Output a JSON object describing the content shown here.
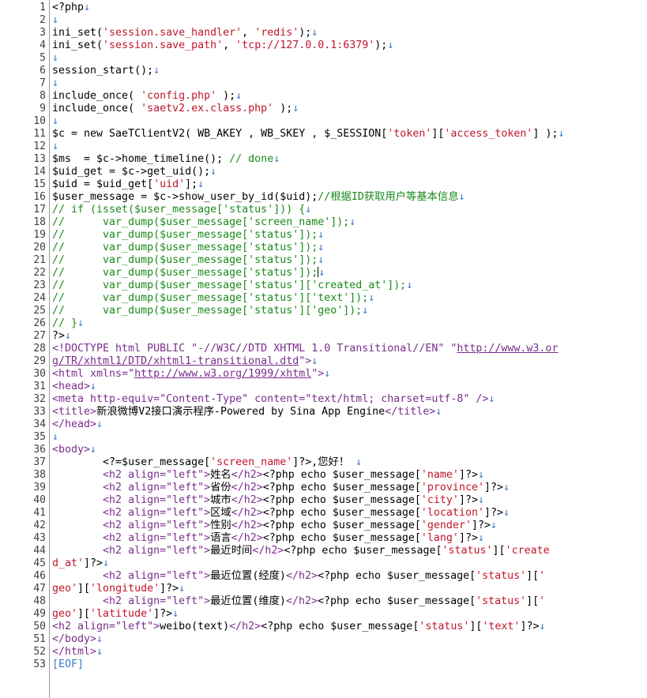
{
  "editor": {
    "eof_marker": "[EOF]",
    "lines": [
      {
        "n": "1",
        "segs": [
          {
            "c": "key",
            "t": "<?php"
          }
        ]
      },
      {
        "n": "2",
        "segs": []
      },
      {
        "n": "3",
        "segs": [
          {
            "c": "key",
            "t": "ini_set("
          },
          {
            "c": "str",
            "t": "'session.save_handler'"
          },
          {
            "c": "key",
            "t": ", "
          },
          {
            "c": "str",
            "t": "'redis'"
          },
          {
            "c": "key",
            "t": ");"
          }
        ]
      },
      {
        "n": "4",
        "segs": [
          {
            "c": "key",
            "t": "ini_set("
          },
          {
            "c": "str",
            "t": "'session.save_path'"
          },
          {
            "c": "key",
            "t": ", "
          },
          {
            "c": "str",
            "t": "'tcp://127.0.0.1:6379'"
          },
          {
            "c": "key",
            "t": ");"
          }
        ]
      },
      {
        "n": "5",
        "segs": []
      },
      {
        "n": "6",
        "segs": [
          {
            "c": "key",
            "t": "session_start();"
          }
        ]
      },
      {
        "n": "7",
        "segs": []
      },
      {
        "n": "8",
        "segs": [
          {
            "c": "key",
            "t": "include_once( "
          },
          {
            "c": "str",
            "t": "'config.php'"
          },
          {
            "c": "key",
            "t": " );"
          }
        ]
      },
      {
        "n": "9",
        "segs": [
          {
            "c": "key",
            "t": "include_once( "
          },
          {
            "c": "str",
            "t": "'saetv2.ex.class.php'"
          },
          {
            "c": "key",
            "t": " );"
          }
        ]
      },
      {
        "n": "10",
        "segs": []
      },
      {
        "n": "11",
        "segs": [
          {
            "c": "key",
            "t": "$c = new SaeTClientV2( WB_AKEY , WB_SKEY , $_SESSION["
          },
          {
            "c": "str",
            "t": "'token'"
          },
          {
            "c": "key",
            "t": "]["
          },
          {
            "c": "str",
            "t": "'access_token'"
          },
          {
            "c": "key",
            "t": "] );"
          }
        ]
      },
      {
        "n": "12",
        "segs": []
      },
      {
        "n": "13",
        "segs": [
          {
            "c": "key",
            "t": "$ms  = $c->home_timeline(); "
          },
          {
            "c": "com",
            "t": "// done"
          }
        ]
      },
      {
        "n": "14",
        "segs": [
          {
            "c": "key",
            "t": "$uid_get = $c->get_uid();"
          }
        ]
      },
      {
        "n": "15",
        "segs": [
          {
            "c": "key",
            "t": "$uid = $uid_get["
          },
          {
            "c": "str",
            "t": "'uid'"
          },
          {
            "c": "key",
            "t": "];"
          }
        ]
      },
      {
        "n": "16",
        "segs": [
          {
            "c": "key",
            "t": "$user_message = $c->show_user_by_id($uid);"
          },
          {
            "c": "com",
            "t": "//根据ID获取用户等基本信息"
          }
        ]
      },
      {
        "n": "17",
        "segs": [
          {
            "c": "com",
            "t": "// if (isset($user_message['status'])) {"
          }
        ]
      },
      {
        "n": "18",
        "segs": [
          {
            "c": "com",
            "t": "//      var_dump($user_message['screen_name']);"
          }
        ]
      },
      {
        "n": "19",
        "segs": [
          {
            "c": "com",
            "t": "//      var_dump($user_message['status']);"
          }
        ]
      },
      {
        "n": "20",
        "segs": [
          {
            "c": "com",
            "t": "//      var_dump($user_message['status']);"
          }
        ]
      },
      {
        "n": "21",
        "segs": [
          {
            "c": "com",
            "t": "//      var_dump($user_message['status']);"
          }
        ]
      },
      {
        "n": "22",
        "segs": [
          {
            "c": "com",
            "t": "//      var_dump($user_message['status']);"
          }
        ],
        "caret": true
      },
      {
        "n": "23",
        "segs": [
          {
            "c": "com",
            "t": "//      var_dump($user_message['status']['created_at']);"
          }
        ]
      },
      {
        "n": "24",
        "segs": [
          {
            "c": "com",
            "t": "//      var_dump($user_message['status']['text']);"
          }
        ]
      },
      {
        "n": "25",
        "segs": [
          {
            "c": "com",
            "t": "//      var_dump($user_message['status']['geo']);"
          }
        ]
      },
      {
        "n": "26",
        "segs": [
          {
            "c": "com",
            "t": "// }"
          }
        ]
      },
      {
        "n": "27",
        "segs": [
          {
            "c": "key",
            "t": "?>"
          }
        ]
      },
      {
        "n": "28",
        "segs": [
          {
            "c": "tag",
            "t": "<!DOCTYPE html PUBLIC \"-//W3C//DTD XHTML 1.0 Transitional//EN\" \""
          },
          {
            "c": "tagu",
            "t": "http://www.w3.or"
          }
        ],
        "noarrow": true
      },
      {
        "n": "29",
        "segs": [
          {
            "c": "tagu",
            "t": "g/TR/xhtml1/DTD/xhtml1-transitional.dtd"
          },
          {
            "c": "tag",
            "t": "\">"
          }
        ]
      },
      {
        "n": "30",
        "segs": [
          {
            "c": "tag",
            "t": "<html xmlns=\""
          },
          {
            "c": "tagu",
            "t": "http://www.w3.org/1999/xhtml"
          },
          {
            "c": "tag",
            "t": "\">"
          }
        ]
      },
      {
        "n": "31",
        "segs": [
          {
            "c": "tag",
            "t": "<head>"
          }
        ]
      },
      {
        "n": "32",
        "segs": [
          {
            "c": "tag",
            "t": "<meta http-equiv=\"Content-Type\" content=\"text/html; charset=utf-8\" />"
          }
        ]
      },
      {
        "n": "33",
        "segs": [
          {
            "c": "tag",
            "t": "<title>"
          },
          {
            "c": "txt",
            "t": "新浪微博V2接口演示程序-Powered by Sina App Engine"
          },
          {
            "c": "tag",
            "t": "</title>"
          }
        ]
      },
      {
        "n": "34",
        "segs": [
          {
            "c": "tag",
            "t": "</head>"
          }
        ]
      },
      {
        "n": "35",
        "segs": []
      },
      {
        "n": "36",
        "segs": [
          {
            "c": "tag",
            "t": "<body>"
          }
        ]
      },
      {
        "n": "37",
        "segs": [
          {
            "c": "key",
            "t": "        <?=$user_message["
          },
          {
            "c": "str",
            "t": "'screen_name'"
          },
          {
            "c": "key",
            "t": "]?>"
          },
          {
            "c": "txt",
            "t": ",您好！ "
          }
        ]
      },
      {
        "n": "38",
        "segs": [
          {
            "c": "tag",
            "t": "        <h2 align=\"left\">"
          },
          {
            "c": "txt",
            "t": "姓名"
          },
          {
            "c": "tag",
            "t": "</h2>"
          },
          {
            "c": "key",
            "t": "<?php echo $user_message["
          },
          {
            "c": "str",
            "t": "'name'"
          },
          {
            "c": "key",
            "t": "]?>"
          }
        ]
      },
      {
        "n": "39",
        "segs": [
          {
            "c": "tag",
            "t": "        <h2 align=\"left\">"
          },
          {
            "c": "txt",
            "t": "省份"
          },
          {
            "c": "tag",
            "t": "</h2>"
          },
          {
            "c": "key",
            "t": "<?php echo $user_message["
          },
          {
            "c": "str",
            "t": "'province'"
          },
          {
            "c": "key",
            "t": "]?>"
          }
        ]
      },
      {
        "n": "40",
        "segs": [
          {
            "c": "tag",
            "t": "        <h2 align=\"left\">"
          },
          {
            "c": "txt",
            "t": "城市"
          },
          {
            "c": "tag",
            "t": "</h2>"
          },
          {
            "c": "key",
            "t": "<?php echo $user_message["
          },
          {
            "c": "str",
            "t": "'city'"
          },
          {
            "c": "key",
            "t": "]?>"
          }
        ]
      },
      {
        "n": "41",
        "segs": [
          {
            "c": "tag",
            "t": "        <h2 align=\"left\">"
          },
          {
            "c": "txt",
            "t": "区域"
          },
          {
            "c": "tag",
            "t": "</h2>"
          },
          {
            "c": "key",
            "t": "<?php echo $user_message["
          },
          {
            "c": "str",
            "t": "'location'"
          },
          {
            "c": "key",
            "t": "]?>"
          }
        ]
      },
      {
        "n": "42",
        "segs": [
          {
            "c": "tag",
            "t": "        <h2 align=\"left\">"
          },
          {
            "c": "txt",
            "t": "性别"
          },
          {
            "c": "tag",
            "t": "</h2>"
          },
          {
            "c": "key",
            "t": "<?php echo $user_message["
          },
          {
            "c": "str",
            "t": "'gender'"
          },
          {
            "c": "key",
            "t": "]?>"
          }
        ]
      },
      {
        "n": "43",
        "segs": [
          {
            "c": "tag",
            "t": "        <h2 align=\"left\">"
          },
          {
            "c": "txt",
            "t": "语言"
          },
          {
            "c": "tag",
            "t": "</h2>"
          },
          {
            "c": "key",
            "t": "<?php echo $user_message["
          },
          {
            "c": "str",
            "t": "'lang'"
          },
          {
            "c": "key",
            "t": "]?>"
          }
        ]
      },
      {
        "n": "44",
        "segs": [
          {
            "c": "tag",
            "t": "        <h2 align=\"left\">"
          },
          {
            "c": "txt",
            "t": "最近时间"
          },
          {
            "c": "tag",
            "t": "</h2>"
          },
          {
            "c": "key",
            "t": "<?php echo $user_message["
          },
          {
            "c": "str",
            "t": "'status'"
          },
          {
            "c": "key",
            "t": "]["
          },
          {
            "c": "str",
            "t": "'create"
          }
        ],
        "noarrow": true
      },
      {
        "n": "45",
        "segs": [
          {
            "c": "str",
            "t": "d_at'"
          },
          {
            "c": "key",
            "t": "]?>"
          }
        ]
      },
      {
        "n": "46",
        "segs": [
          {
            "c": "tag",
            "t": "        <h2 align=\"left\">"
          },
          {
            "c": "txt",
            "t": "最近位置(经度)"
          },
          {
            "c": "tag",
            "t": "</h2>"
          },
          {
            "c": "key",
            "t": "<?php echo $user_message["
          },
          {
            "c": "str",
            "t": "'status'"
          },
          {
            "c": "key",
            "t": "]["
          },
          {
            "c": "str",
            "t": "'"
          }
        ],
        "noarrow": true
      },
      {
        "n": "47",
        "segs": [
          {
            "c": "str",
            "t": "geo'"
          },
          {
            "c": "key",
            "t": "]["
          },
          {
            "c": "str",
            "t": "'longitude'"
          },
          {
            "c": "key",
            "t": "]?>"
          }
        ]
      },
      {
        "n": "48",
        "segs": [
          {
            "c": "tag",
            "t": "        <h2 align=\"left\">"
          },
          {
            "c": "txt",
            "t": "最近位置(维度)"
          },
          {
            "c": "tag",
            "t": "</h2>"
          },
          {
            "c": "key",
            "t": "<?php echo $user_message["
          },
          {
            "c": "str",
            "t": "'status'"
          },
          {
            "c": "key",
            "t": "]["
          },
          {
            "c": "str",
            "t": "'"
          }
        ],
        "noarrow": true
      },
      {
        "n": "49",
        "segs": [
          {
            "c": "str",
            "t": "geo'"
          },
          {
            "c": "key",
            "t": "]["
          },
          {
            "c": "str",
            "t": "'latitude'"
          },
          {
            "c": "key",
            "t": "]?>"
          }
        ]
      },
      {
        "n": "50",
        "segs": [
          {
            "c": "tag",
            "t": "<h2 align=\"left\">"
          },
          {
            "c": "txt",
            "t": "weibo(text)"
          },
          {
            "c": "tag",
            "t": "</h2>"
          },
          {
            "c": "key",
            "t": "<?php echo $user_message["
          },
          {
            "c": "str",
            "t": "'status'"
          },
          {
            "c": "key",
            "t": "]["
          },
          {
            "c": "str",
            "t": "'text'"
          },
          {
            "c": "key",
            "t": "]?>"
          }
        ]
      },
      {
        "n": "51",
        "segs": [
          {
            "c": "tag",
            "t": "</body>"
          }
        ]
      },
      {
        "n": "52",
        "segs": [
          {
            "c": "tag",
            "t": "</html>"
          }
        ]
      },
      {
        "n": "53",
        "segs": [],
        "eof": true
      }
    ],
    "line_end_arrow": "↓"
  }
}
